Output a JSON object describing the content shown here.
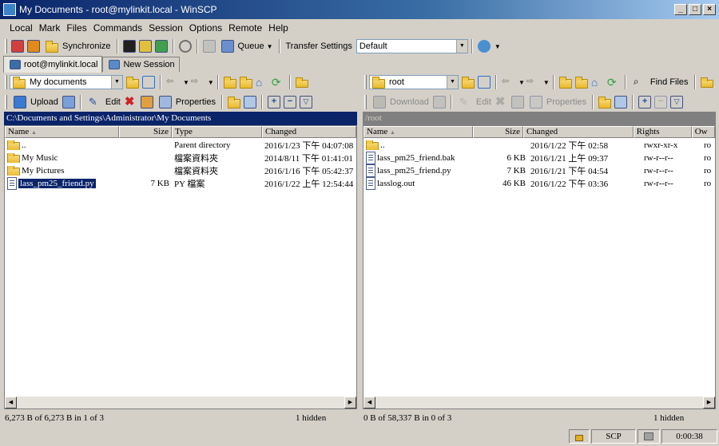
{
  "window": {
    "title": "My Documents - root@mylinkit.local - WinSCP",
    "controls": [
      "_",
      "□",
      "×"
    ]
  },
  "menu": [
    "Local",
    "Mark",
    "Files",
    "Commands",
    "Session",
    "Options",
    "Remote",
    "Help"
  ],
  "toolbar": {
    "synchronize_label": "Synchronize",
    "queue_label": "Queue",
    "transfer_settings_label": "Transfer Settings",
    "transfer_settings_value": "Default"
  },
  "tabs": [
    {
      "label": "root@mylinkit.local"
    },
    {
      "label": "New Session"
    }
  ],
  "left": {
    "location": "My documents",
    "actions": {
      "upload": "Upload",
      "edit": "Edit",
      "properties": "Properties"
    },
    "path": "C:\\Documents and Settings\\Administrator\\My Documents",
    "columns": [
      "Name",
      "Size",
      "Type",
      "Changed"
    ],
    "rows": [
      {
        "name": "..",
        "size": "",
        "type": "Parent directory",
        "changed": "2016/1/23  下午 04:07:08"
      },
      {
        "name": "My Music",
        "size": "",
        "type": "檔案資料夾",
        "changed": "2014/8/11  下午 01:41:01"
      },
      {
        "name": "My Pictures",
        "size": "",
        "type": "檔案資料夾",
        "changed": "2016/1/16  下午 05:42:37"
      },
      {
        "name": "lass_pm25_friend.py",
        "size": "7 KB",
        "type": "PY 檔案",
        "changed": "2016/1/22  上午 12:54:44"
      }
    ],
    "status": "6,273 B of 6,273 B in 1 of 3",
    "hidden": "1 hidden"
  },
  "right": {
    "location": "root",
    "find_files_label": "Find Files",
    "actions": {
      "download": "Download",
      "edit": "Edit",
      "properties": "Properties"
    },
    "path": "/root",
    "columns": [
      "Name",
      "Size",
      "Changed",
      "Rights",
      "Ow"
    ],
    "rows": [
      {
        "name": "..",
        "size": "",
        "changed": "2016/1/22 下午 02:58",
        "rights": "rwxr-xr-x",
        "owner": "ro"
      },
      {
        "name": "lass_pm25_friend.bak",
        "size": "6 KB",
        "changed": "2016/1/21 上午 09:37",
        "rights": "rw-r--r--",
        "owner": "ro"
      },
      {
        "name": "lass_pm25_friend.py",
        "size": "7 KB",
        "changed": "2016/1/21 下午 04:54",
        "rights": "rw-r--r--",
        "owner": "ro"
      },
      {
        "name": "lasslog.out",
        "size": "46 KB",
        "changed": "2016/1/22 下午 03:36",
        "rights": "rw-r--r--",
        "owner": "ro"
      }
    ],
    "status": "0 B of 58,337 B in 0 of 3",
    "hidden": "1 hidden"
  },
  "statusbar": {
    "protocol": "SCP",
    "elapsed": "0:00:38"
  }
}
